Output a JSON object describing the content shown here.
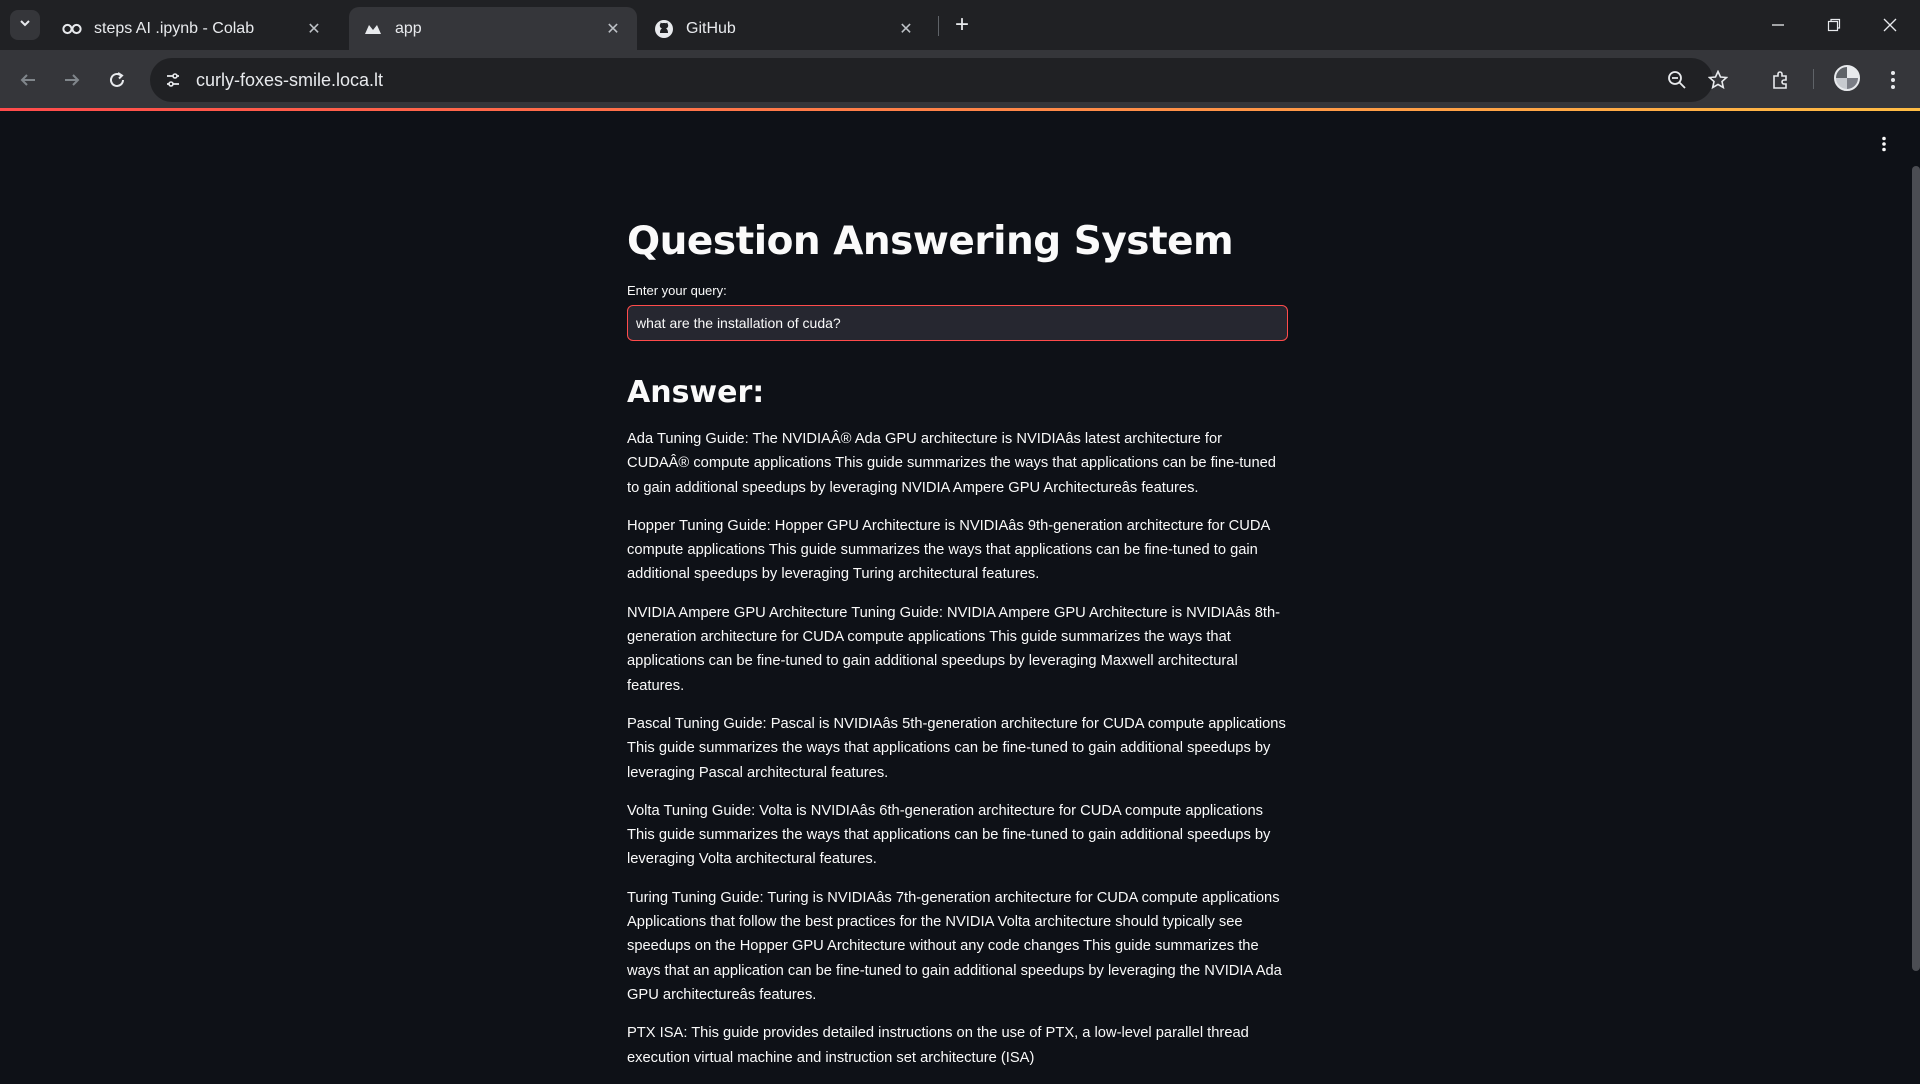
{
  "browser": {
    "tabs": [
      {
        "title": "steps AI .ipynb - Colab",
        "icon": "colab-icon",
        "active": false
      },
      {
        "title": "app",
        "icon": "streamlit-icon",
        "active": true
      },
      {
        "title": "GitHub",
        "icon": "github-icon",
        "active": false
      }
    ],
    "url": "curly-foxes-smile.loca.lt"
  },
  "app": {
    "title": "Question Answering System",
    "query_label": "Enter your query:",
    "query_value": "what are the installation of cuda?",
    "answer_heading": "Answer:",
    "answers": [
      "Ada Tuning Guide: The NVIDIAÂ® Ada GPU architecture is NVIDIAâs latest architecture for CUDAÂ® compute applications This guide summarizes the ways that applications can be fine-tuned to gain additional speedups by leveraging NVIDIA Ampere GPU Architectureâs features.",
      "Hopper Tuning Guide: Hopper GPU Architecture is NVIDIAâs 9th-generation architecture for CUDA compute applications This guide summarizes the ways that applications can be fine-tuned to gain additional speedups by leveraging Turing architectural features.",
      "NVIDIA Ampere GPU Architecture Tuning Guide: NVIDIA Ampere GPU Architecture is NVIDIAâs 8th-generation architecture for CUDA compute applications This guide summarizes the ways that applications can be fine-tuned to gain additional speedups by leveraging Maxwell architectural features.",
      "Pascal Tuning Guide: Pascal is NVIDIAâs 5th-generation architecture for CUDA compute applications This guide summarizes the ways that applications can be fine-tuned to gain additional speedups by leveraging Pascal architectural features.",
      "Volta Tuning Guide: Volta is NVIDIAâs 6th-generation architecture for CUDA compute applications This guide summarizes the ways that applications can be fine-tuned to gain additional speedups by leveraging Volta architectural features.",
      "Turing Tuning Guide: Turing is NVIDIAâs 7th-generation architecture for CUDA compute applications Applications that follow the best practices for the NVIDIA Volta architecture should typically see speedups on the Hopper GPU Architecture without any code changes This guide summarizes the ways that an application can be fine-tuned to gain additional speedups by leveraging the NVIDIA Ada GPU architectureâs features.",
      "PTX ISA: This guide provides detailed instructions on the use of PTX, a low-level parallel thread execution virtual machine and instruction set architecture (ISA)"
    ]
  },
  "colors": {
    "page_bg": "#0e1117",
    "input_bg": "#262730",
    "accent": "#ff4b4b",
    "accent_secondary": "#ffbd45"
  }
}
